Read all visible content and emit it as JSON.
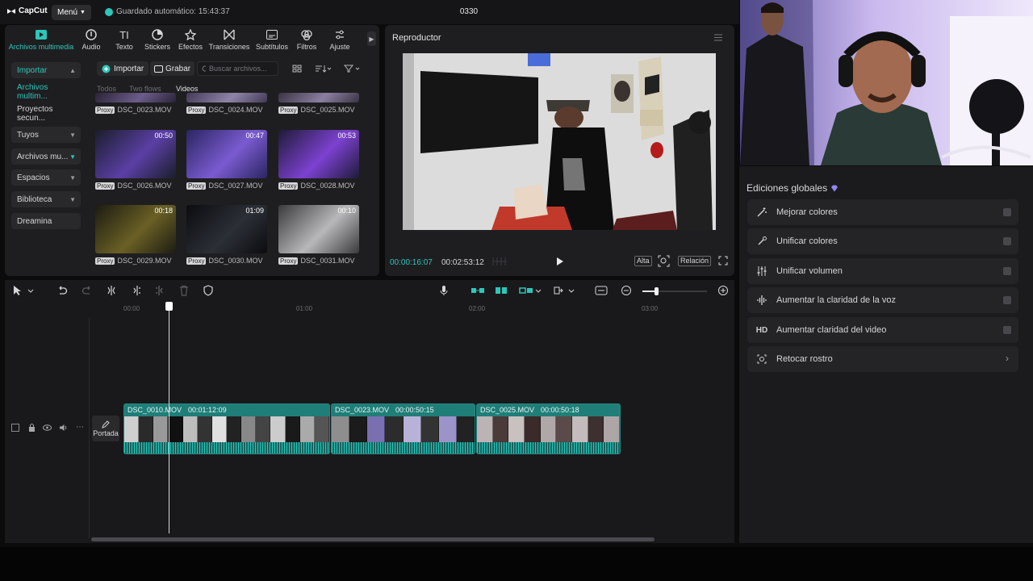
{
  "app": {
    "logo": "CapCut",
    "menu_label": "Menú",
    "autosave": "Guardado automático: 15:43:37",
    "project_title": "0330"
  },
  "toolbar": {
    "tabs": [
      {
        "label": "Archivos multimedia",
        "icon": "media-icon"
      },
      {
        "label": "Audio",
        "icon": "audio-icon"
      },
      {
        "label": "Texto",
        "icon": "text-icon"
      },
      {
        "label": "Stickers",
        "icon": "sticker-icon"
      },
      {
        "label": "Efectos",
        "icon": "effects-icon"
      },
      {
        "label": "Transiciones",
        "icon": "transition-icon"
      },
      {
        "label": "Subtítulos",
        "icon": "subtitle-icon"
      },
      {
        "label": "Filtros",
        "icon": "filter-icon"
      },
      {
        "label": "Ajuste",
        "icon": "adjust-icon"
      }
    ]
  },
  "sidebar": {
    "items": [
      {
        "label": "Importar"
      },
      {
        "label": "Archivos multim..."
      },
      {
        "label": "Proyectos secun..."
      },
      {
        "label": "Tuyos"
      },
      {
        "label": "Archivos mu..."
      },
      {
        "label": "Espacios"
      },
      {
        "label": "Biblioteca"
      },
      {
        "label": "Dreamina"
      }
    ]
  },
  "media": {
    "import_label": "Importar",
    "record_label": "Grabar",
    "search_placeholder": "Buscar archivos...",
    "filters": [
      "Todos",
      "Two flows",
      "Videos"
    ],
    "proxy_label": "Proxy",
    "clips": [
      {
        "name": "DSC_0023.MOV",
        "duration": ""
      },
      {
        "name": "DSC_0024.MOV",
        "duration": ""
      },
      {
        "name": "DSC_0025.MOV",
        "duration": ""
      },
      {
        "name": "DSC_0026.MOV",
        "duration": "00:50"
      },
      {
        "name": "DSC_0027.MOV",
        "duration": "00:47"
      },
      {
        "name": "DSC_0028.MOV",
        "duration": "00:53"
      },
      {
        "name": "DSC_0029.MOV",
        "duration": "00:18"
      },
      {
        "name": "DSC_0030.MOV",
        "duration": "01:09"
      },
      {
        "name": "DSC_0031.MOV",
        "duration": "00:10"
      }
    ]
  },
  "player": {
    "title": "Reproductor",
    "current_time": "00:00:16:07",
    "total_time": "00:02:53:12",
    "quality_label": "Alta",
    "ratio_label": "Relación"
  },
  "timeline": {
    "ruler": [
      "00:00",
      "01:00",
      "02:00",
      "03:00"
    ],
    "cover_label": "Portada",
    "clips": [
      {
        "name": "DSC_0010.MOV",
        "duration": "00:01:12:09"
      },
      {
        "name": "DSC_0023.MOV",
        "duration": "00:00:50:15"
      },
      {
        "name": "DSC_0025.MOV",
        "duration": "00:00:50:18"
      }
    ]
  },
  "global_edits": {
    "title": "Ediciones globales",
    "items": [
      {
        "label": "Mejorar colores",
        "icon": "magic-wand-icon"
      },
      {
        "label": "Unificar colores",
        "icon": "color-match-icon"
      },
      {
        "label": "Unificar volumen",
        "icon": "volume-sliders-icon"
      },
      {
        "label": "Aumentar la claridad de la voz",
        "icon": "voice-wave-icon"
      },
      {
        "label": "Aumentar claridad del video",
        "icon": "hd-icon"
      },
      {
        "label": "Retocar rostro",
        "icon": "face-retouch-icon"
      }
    ],
    "hd_glyph": "HD"
  },
  "colors": {
    "accent": "#2ec6b9",
    "clip": "#1f7e78",
    "panel": "#1e1e21"
  }
}
